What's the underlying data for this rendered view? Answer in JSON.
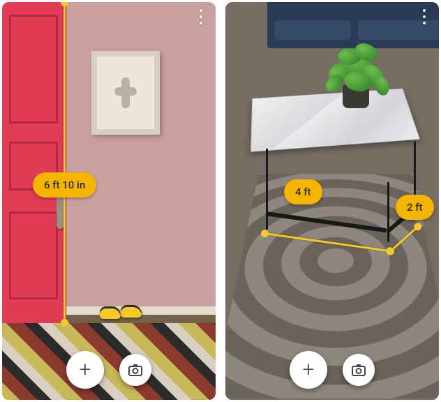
{
  "screens": [
    {
      "measurements": [
        {
          "label": "6 ft 10 in"
        }
      ]
    },
    {
      "measurements": [
        {
          "label": "4 ft"
        },
        {
          "label": "2 ft"
        }
      ]
    }
  ],
  "icons": {
    "overflow": "more-vert-icon",
    "add": "plus-icon",
    "camera": "camera-icon"
  }
}
